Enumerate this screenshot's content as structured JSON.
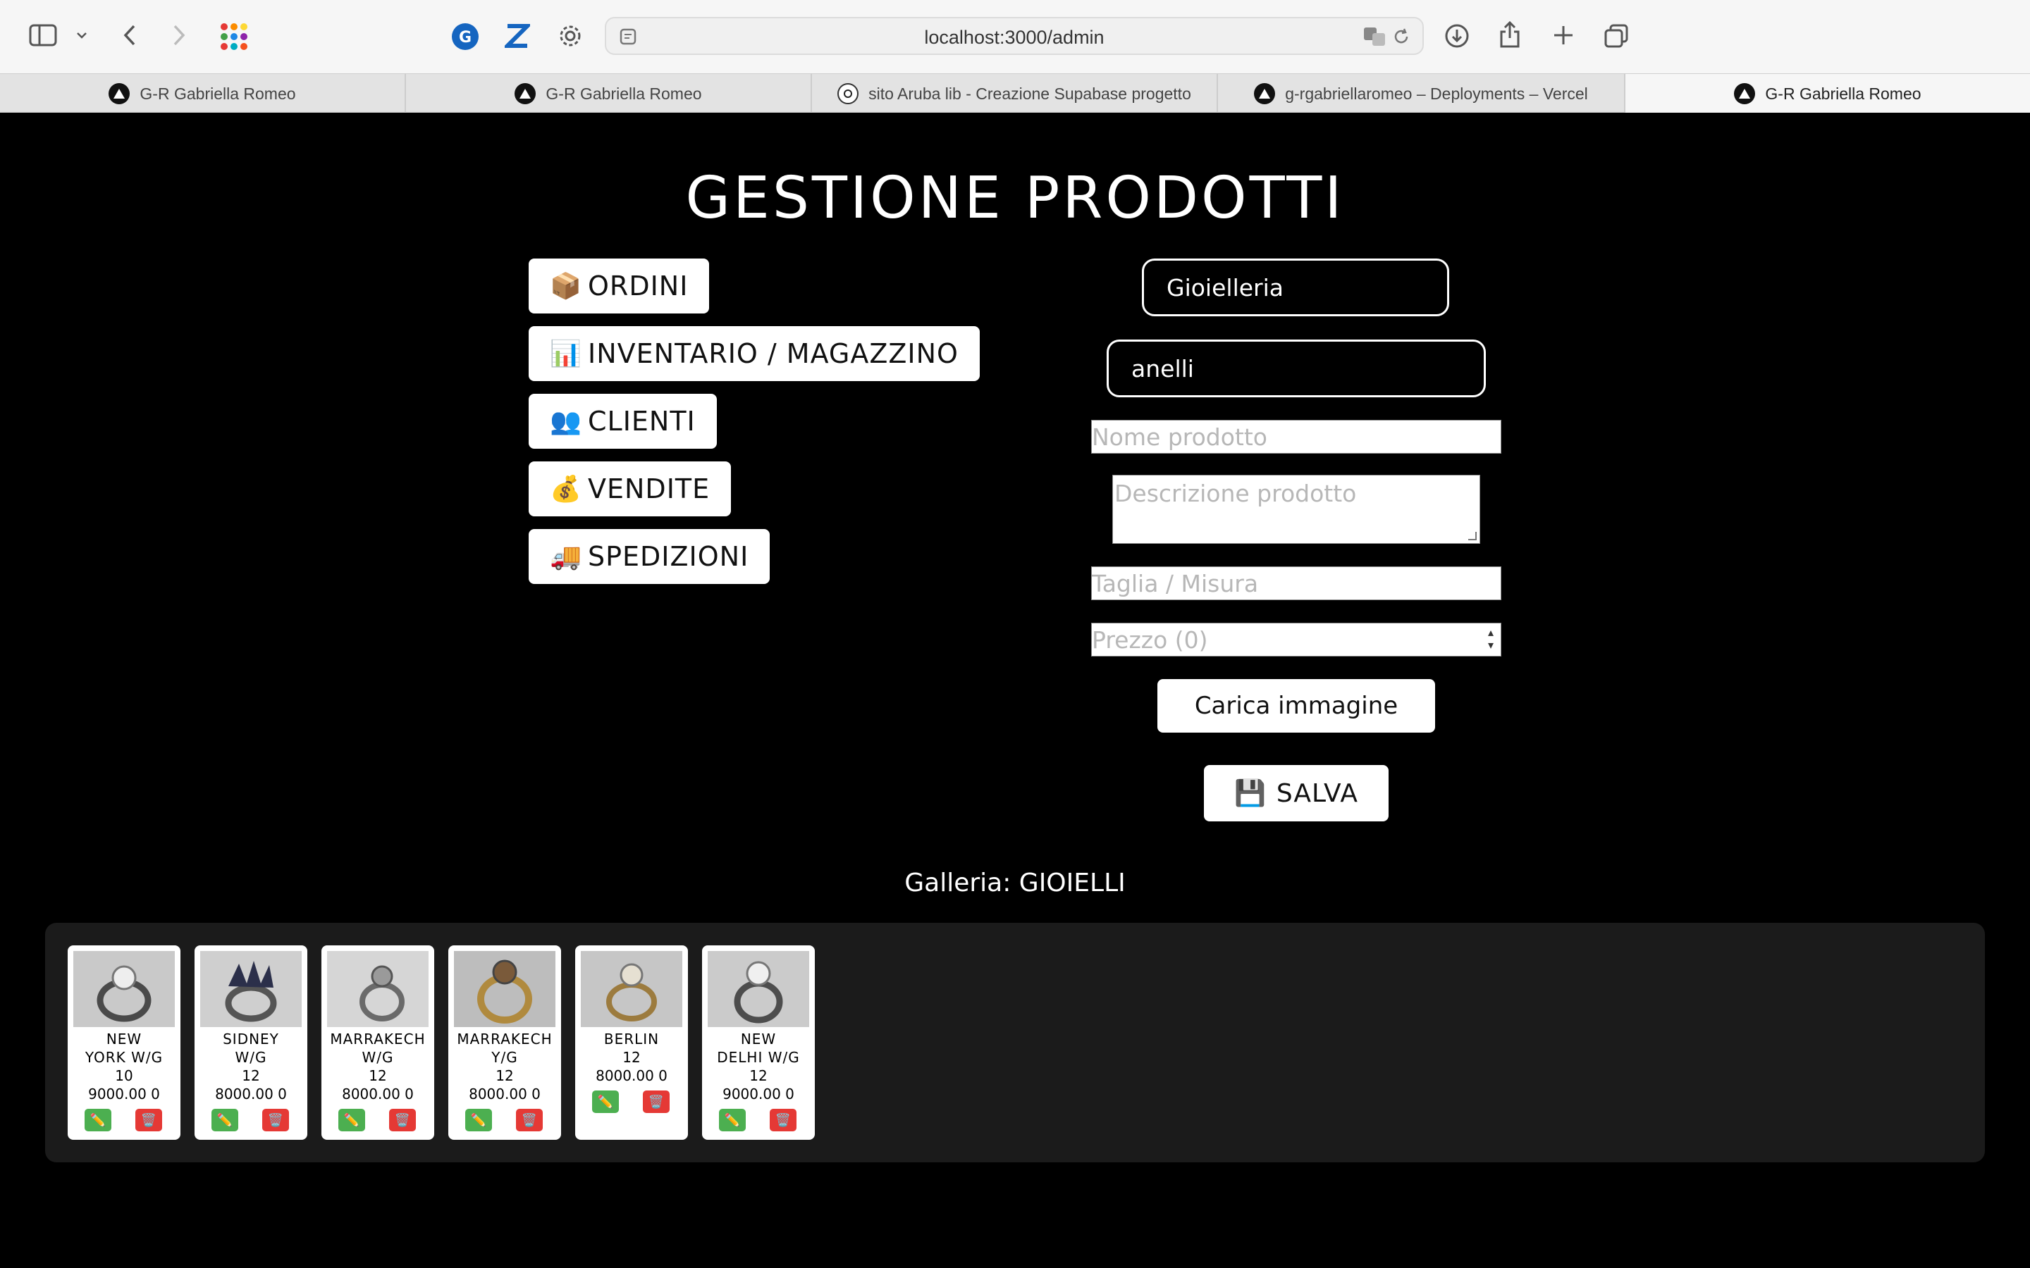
{
  "browser": {
    "url": "localhost:3000/admin",
    "tabs": [
      {
        "title": "G-R Gabriella Romeo",
        "active": false
      },
      {
        "title": "G-R Gabriella Romeo",
        "active": false
      },
      {
        "title": "sito Aruba lib - Creazione Supabase progetto",
        "active": false
      },
      {
        "title": "g-rgabriellaromeo – Deployments – Vercel",
        "active": false
      },
      {
        "title": "G-R Gabriella Romeo",
        "active": true
      }
    ]
  },
  "page": {
    "title": "GESTIONE PRODOTTI",
    "nav": [
      {
        "icon": "📦",
        "label": "ORDINI"
      },
      {
        "icon": "📊",
        "label": "INVENTARIO / MAGAZZINO"
      },
      {
        "icon": "👥",
        "label": "CLIENTI"
      },
      {
        "icon": "💰",
        "label": "VENDITE"
      },
      {
        "icon": "🚚",
        "label": "SPEDIZIONI"
      }
    ],
    "form": {
      "category": "Gioielleria",
      "subcategory": "anelli",
      "name_placeholder": "Nome prodotto",
      "description_placeholder": "Descrizione prodotto",
      "size_placeholder": "Taglia / Misura",
      "price_placeholder": "Prezzo (0)",
      "upload_label": "Carica immagine",
      "save_icon": "💾",
      "save_label": "SALVA"
    },
    "gallery_title": "Galleria: GIOIELLI",
    "products": [
      {
        "name": "NEW\nYORK W/G",
        "size": "10",
        "price": "9000.00 0"
      },
      {
        "name": "SIDNEY\nW/G",
        "size": "12",
        "price": "8000.00 0"
      },
      {
        "name": "MARRAKECH\nW/G",
        "size": "12",
        "price": "8000.00 0"
      },
      {
        "name": "MARRAKECH\nY/G",
        "size": "12",
        "price": "8000.00 0"
      },
      {
        "name": "BERLIN",
        "size": "12",
        "price": "8000.00 0"
      },
      {
        "name": "NEW\nDELHI W/G",
        "size": "12",
        "price": "9000.00 0"
      }
    ],
    "card_actions": {
      "edit_icon": "✏️",
      "delete_icon": "🗑️"
    }
  },
  "colors": {
    "edit": "#4caf50",
    "delete": "#e53935",
    "background": "#000000",
    "gallery_bg": "#1b1b1b"
  }
}
